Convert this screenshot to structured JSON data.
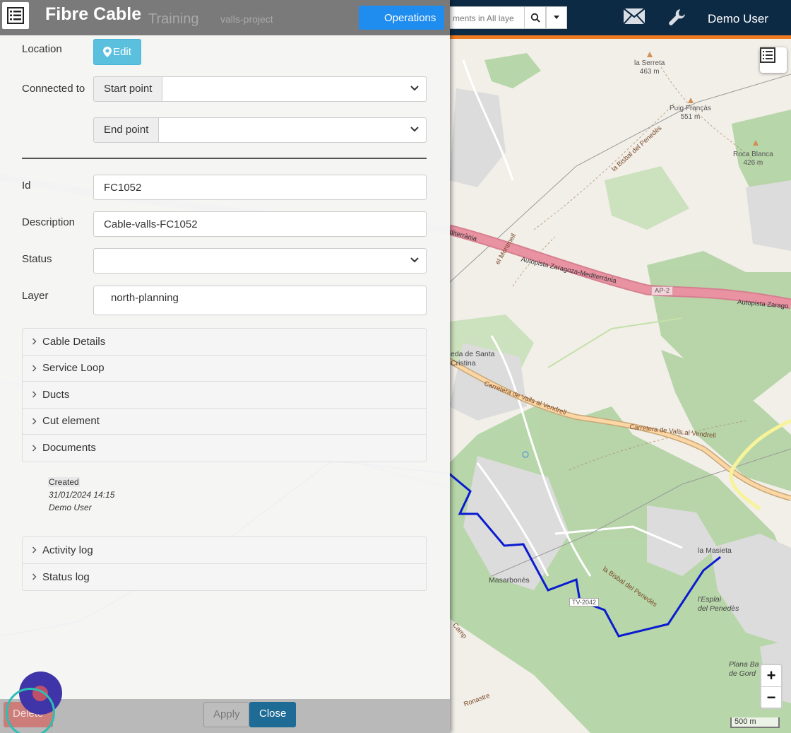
{
  "navbar": {
    "search_placeholder": "ments in All laye",
    "user": "Demo User",
    "ghost_training": "Training",
    "ghost_project": "valls-project"
  },
  "panel": {
    "title": "Fibre Cable",
    "operations": "Operations",
    "location_label": "Location",
    "edit_label": "Edit",
    "connected_label": "Connected to",
    "start_point_label": "Start point",
    "start_point_value": "",
    "end_point_label": "End point",
    "end_point_value": "",
    "id_label": "Id",
    "id_value": "FC1052",
    "description_label": "Description",
    "description_value": "Cable-valls-FC1052",
    "status_label": "Status",
    "status_value": "",
    "layer_label": "Layer",
    "layer_value": "north-planning",
    "sections": [
      "Cable Details",
      "Service Loop",
      "Ducts",
      "Cut element",
      "Documents"
    ],
    "created_label": "Created",
    "created_date": "31/01/2024 14:15",
    "created_user": "Demo User",
    "logs": [
      "Activity log",
      "Status log"
    ],
    "delete": "Delete",
    "apply": "Apply",
    "close": "Close"
  },
  "map": {
    "labels": {
      "la_serreta": "la Serreta",
      "la_serreta_elev": "463 m",
      "puig_francas": "Puig Françàs",
      "puig_francas_elev": "551 m",
      "roca_blanca": "Roca Blanca",
      "roca_blanca_elev": "426 m",
      "bisbal_road": "la Bisbal del Penedès",
      "autopista": "Autopista Zaragoza-Mediterrània",
      "autopista_left": "diterrània",
      "autopista_right": "Autopista Zarago",
      "ap2": "AP-2",
      "el_montmell": "el Montmell",
      "santa_cristina_1": "eda de Santa",
      "santa_cristina_2": "Cristina",
      "carretera_1": "Carretera de Valls al Vendrell",
      "carretera_2": "Carretera de Valls al Vendrell",
      "la_masieta": "la Masieta",
      "masarbones": "Masarbonès",
      "tv2042": "TV-2042",
      "bisbal_2": "la Bisbal del Penedès",
      "esplai": "l'Esplai",
      "esplai_2": "del Penedès",
      "plana_1": "Plana Ba",
      "plana_2": "de Gord",
      "camp": "Camp",
      "ronastre": "Ronastre"
    },
    "scale": "500 m",
    "zoom_in": "+",
    "zoom_out": "−",
    "cable_color": "#0a1ccf",
    "motorway_color": "#e892a2",
    "orange_line": "#f07c22"
  }
}
